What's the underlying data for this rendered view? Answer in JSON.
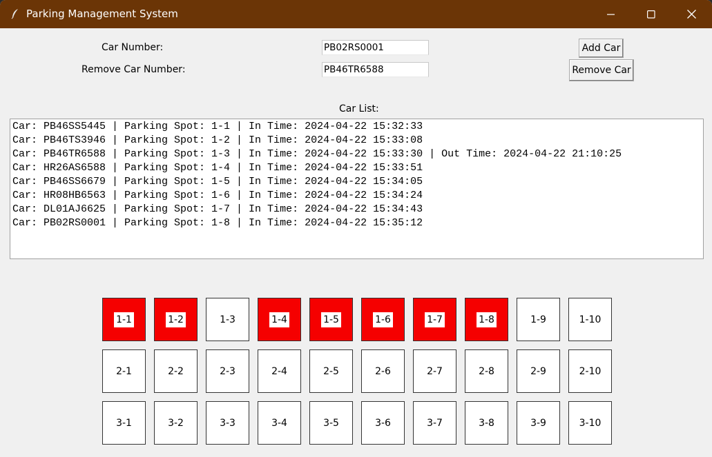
{
  "window": {
    "title": "Parking Management System"
  },
  "form": {
    "car_number_label": "Car Number:",
    "car_number_value": "PB02RS0001",
    "remove_car_label": "Remove Car Number:",
    "remove_car_value": "PB46TR6588",
    "add_button": "Add Car",
    "remove_button": "Remove Car"
  },
  "car_list": {
    "label": "Car List:",
    "items": [
      "Car: PB46SS5445 | Parking Spot: 1-1 | In Time: 2024-04-22 15:32:33",
      "Car: PB46TS3946 | Parking Spot: 1-2 | In Time: 2024-04-22 15:33:08",
      "Car: PB46TR6588 | Parking Spot: 1-3 | In Time: 2024-04-22 15:33:30 | Out Time: 2024-04-22 21:10:25",
      "Car: HR26AS6588 | Parking Spot: 1-4 | In Time: 2024-04-22 15:33:51",
      "Car: PB46SS6679 | Parking Spot: 1-5 | In Time: 2024-04-22 15:34:05",
      "Car: HR08HB6563 | Parking Spot: 1-6 | In Time: 2024-04-22 15:34:24",
      "Car: DL01AJ6625 | Parking Spot: 1-7 | In Time: 2024-04-22 15:34:43",
      "Car: PB02RS0001 | Parking Spot: 1-8 | In Time: 2024-04-22 15:35:12"
    ]
  },
  "colors": {
    "titlebar": "#6b3506",
    "occupied": "#f50000",
    "free": "#ffffff"
  },
  "spots": [
    [
      {
        "label": "1-1",
        "occupied": true
      },
      {
        "label": "1-2",
        "occupied": true
      },
      {
        "label": "1-3",
        "occupied": false
      },
      {
        "label": "1-4",
        "occupied": true
      },
      {
        "label": "1-5",
        "occupied": true
      },
      {
        "label": "1-6",
        "occupied": true
      },
      {
        "label": "1-7",
        "occupied": true
      },
      {
        "label": "1-8",
        "occupied": true
      },
      {
        "label": "1-9",
        "occupied": false
      },
      {
        "label": "1-10",
        "occupied": false
      }
    ],
    [
      {
        "label": "2-1",
        "occupied": false
      },
      {
        "label": "2-2",
        "occupied": false
      },
      {
        "label": "2-3",
        "occupied": false
      },
      {
        "label": "2-4",
        "occupied": false
      },
      {
        "label": "2-5",
        "occupied": false
      },
      {
        "label": "2-6",
        "occupied": false
      },
      {
        "label": "2-7",
        "occupied": false
      },
      {
        "label": "2-8",
        "occupied": false
      },
      {
        "label": "2-9",
        "occupied": false
      },
      {
        "label": "2-10",
        "occupied": false
      }
    ],
    [
      {
        "label": "3-1",
        "occupied": false
      },
      {
        "label": "3-2",
        "occupied": false
      },
      {
        "label": "3-3",
        "occupied": false
      },
      {
        "label": "3-4",
        "occupied": false
      },
      {
        "label": "3-5",
        "occupied": false
      },
      {
        "label": "3-6",
        "occupied": false
      },
      {
        "label": "3-7",
        "occupied": false
      },
      {
        "label": "3-8",
        "occupied": false
      },
      {
        "label": "3-9",
        "occupied": false
      },
      {
        "label": "3-10",
        "occupied": false
      }
    ]
  ]
}
